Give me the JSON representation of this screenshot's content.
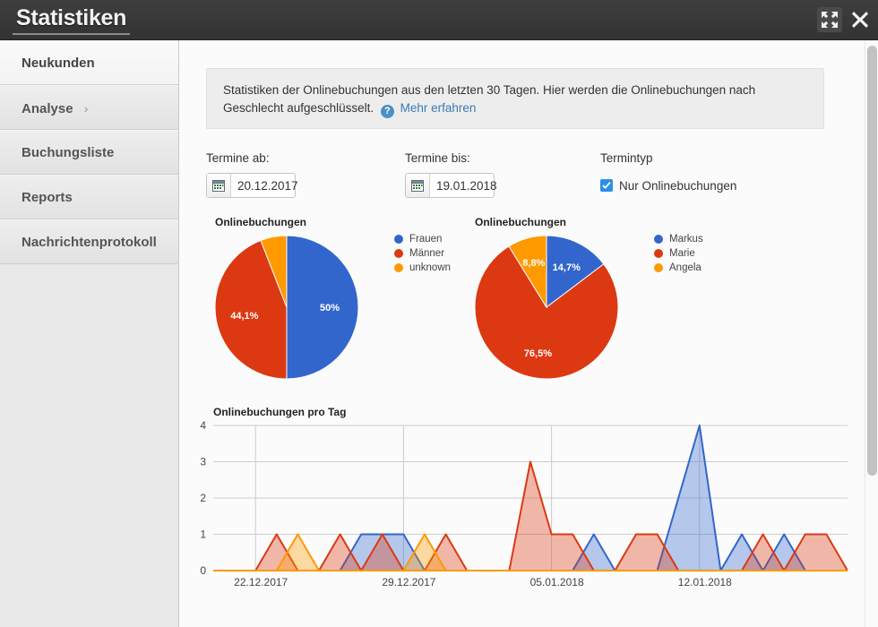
{
  "window": {
    "title": "Statistiken",
    "expand_icon": "expand-icon",
    "close_icon": "close-icon"
  },
  "sidebar": {
    "items": [
      {
        "label": "Neukunden",
        "active": false,
        "chevron": ""
      },
      {
        "label": "Analyse",
        "active": true,
        "chevron": "›"
      },
      {
        "label": "Buchungsliste",
        "active": false,
        "chevron": ""
      },
      {
        "label": "Reports",
        "active": false,
        "chevron": ""
      },
      {
        "label": "Nachrichtenprotokoll",
        "active": false,
        "chevron": ""
      }
    ]
  },
  "info": {
    "text": "Statistiken der Onlinebuchungen aus den letzten 30 Tagen. Hier werden die Onlinebuchungen nach Geschlecht aufgeschlüsselt.",
    "help_icon": "help-icon",
    "link": "Mehr erfahren"
  },
  "filters": {
    "from": {
      "label": "Termine ab:",
      "value": "20.12.2017",
      "icon": "calendar-icon"
    },
    "to": {
      "label": "Termine bis:",
      "value": "19.01.2018",
      "icon": "calendar-icon"
    },
    "type": {
      "label": "Termintyp",
      "checkbox_label": "Nur Onlinebuchungen",
      "checked": true
    }
  },
  "colors": {
    "blue": "#3366cc",
    "red": "#dc3912",
    "orange": "#ff9900",
    "accent_link": "#3a7bb5",
    "checkbox": "#2b8fe8"
  },
  "chart_data": [
    {
      "type": "pie",
      "title": "Onlinebuchungen",
      "labels": [
        "Frauen",
        "Männer",
        "unknown"
      ],
      "values": [
        50.0,
        44.1,
        5.9
      ],
      "value_labels": [
        "50%",
        "44,1%",
        ""
      ],
      "colors": [
        "#3366cc",
        "#dc3912",
        "#ff9900"
      ],
      "legend_position": "right"
    },
    {
      "type": "pie",
      "title": "Onlinebuchungen",
      "labels": [
        "Markus",
        "Marie",
        "Angela"
      ],
      "values": [
        14.7,
        76.5,
        8.8
      ],
      "value_labels": [
        "14,7%",
        "76,5%",
        "8,8%"
      ],
      "colors": [
        "#3366cc",
        "#dc3912",
        "#ff9900"
      ],
      "legend_position": "right"
    },
    {
      "type": "area",
      "title": "Onlinebuchungen pro Tag",
      "xlabel": "",
      "ylabel": "",
      "ylim": [
        0,
        4
      ],
      "yticks": [
        0,
        1,
        2,
        3,
        4
      ],
      "grid": true,
      "legend_position": "none",
      "x": [
        "20.12.2017",
        "21.12.2017",
        "22.12.2017",
        "23.12.2017",
        "24.12.2017",
        "25.12.2017",
        "26.12.2017",
        "27.12.2017",
        "28.12.2017",
        "29.12.2017",
        "30.12.2017",
        "31.12.2017",
        "01.01.2018",
        "02.01.2018",
        "03.01.2018",
        "04.01.2018",
        "05.01.2018",
        "06.01.2018",
        "07.01.2018",
        "08.01.2018",
        "09.01.2018",
        "10.01.2018",
        "11.01.2018",
        "12.01.2018",
        "13.01.2018",
        "14.01.2018",
        "15.01.2018",
        "16.01.2018",
        "17.01.2018",
        "18.01.2018",
        "19.01.2018"
      ],
      "xtick_labels": [
        "22.12.2017",
        "29.12.2017",
        "05.01.2018",
        "12.01.2018"
      ],
      "xtick_indices": [
        2,
        9,
        16,
        23
      ],
      "series": [
        {
          "name": "Frauen",
          "color": "#3366cc",
          "values": [
            0,
            0,
            0,
            0,
            0,
            0,
            0,
            1,
            1,
            1,
            0,
            0,
            0,
            0,
            0,
            0,
            0,
            0,
            1,
            0,
            0,
            0,
            2,
            4,
            0,
            1,
            0,
            1,
            0,
            0,
            0
          ]
        },
        {
          "name": "Männer",
          "color": "#dc3912",
          "values": [
            0,
            0,
            0,
            1,
            0,
            0,
            1,
            0,
            1,
            0,
            0,
            1,
            0,
            0,
            0,
            3,
            1,
            1,
            0,
            0,
            1,
            1,
            0,
            0,
            0,
            0,
            1,
            0,
            1,
            1,
            0
          ]
        },
        {
          "name": "unknown",
          "color": "#ff9900",
          "values": [
            0,
            0,
            0,
            0,
            1,
            0,
            0,
            0,
            0,
            0,
            1,
            0,
            0,
            0,
            0,
            0,
            0,
            0,
            0,
            0,
            0,
            0,
            0,
            0,
            0,
            0,
            0,
            0,
            0,
            0,
            0
          ]
        }
      ]
    }
  ]
}
